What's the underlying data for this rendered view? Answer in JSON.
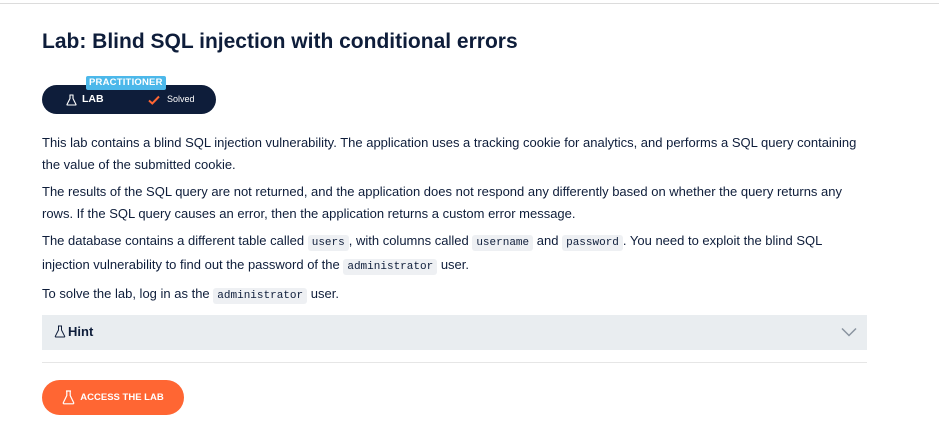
{
  "title": "Lab: Blind SQL injection with conditional errors",
  "badge": {
    "level": "PRACTITIONER",
    "lab_label": "LAB",
    "status": "Solved"
  },
  "description": {
    "p1": "This lab contains a blind SQL injection vulnerability. The application uses a tracking cookie for analytics, and performs a SQL query containing the value of the submitted cookie.",
    "p2": "The results of the SQL query are not returned, and the application does not respond any differently based on whether the query returns any rows. If the SQL query causes an error, then the application returns a custom error message.",
    "p3_a": "The database contains a different table called",
    "p3_code1": "users",
    "p3_b": ", with columns called",
    "p3_code2": "username",
    "p3_c": "and",
    "p3_code3": "password",
    "p3_d": ". You need to exploit the blind SQL injection vulnerability to find out the password of the",
    "p3_code4": "administrator",
    "p3_e": "user.",
    "p4_a": "To solve the lab, log in as the",
    "p4_code": "administrator",
    "p4_b": "user."
  },
  "hint": {
    "label": "Hint"
  },
  "access_button": {
    "label": "ACCESS THE LAB"
  },
  "colors": {
    "navy": "#0e1d3a",
    "practitioner_blue": "#4cb8ea",
    "solved_check": "#ff6633",
    "access_orange": "#ff6633",
    "hint_bg": "#e9edf0"
  },
  "icons": {
    "lab": "flask-icon",
    "solved": "checkmark-icon",
    "hint": "flask-icon",
    "hint_toggle": "chevron-down-icon",
    "access": "flask-icon"
  }
}
